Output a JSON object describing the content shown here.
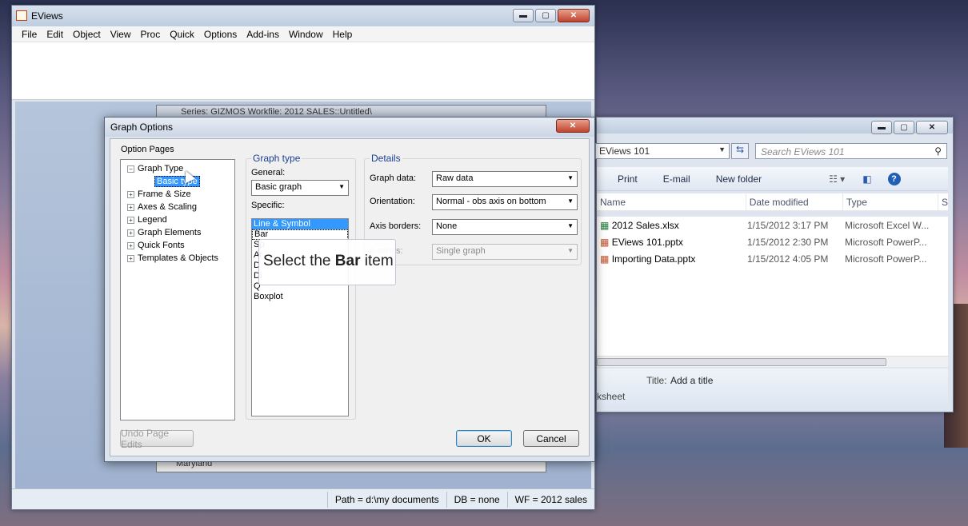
{
  "eviews": {
    "title": "EViews",
    "menu": [
      "File",
      "Edit",
      "Object",
      "View",
      "Proc",
      "Quick",
      "Options",
      "Add-ins",
      "Window",
      "Help"
    ],
    "series_title": "Series: GIZMOS   Workfile: 2012 SALES::Untitled\\",
    "series_bottom": "Maryland",
    "status": {
      "path": "Path = d:\\my documents",
      "db": "DB = none",
      "wf": "WF = 2012 sales"
    }
  },
  "explorer": {
    "address": "EViews 101",
    "search_placeholder": "Search EViews 101",
    "toolbar": {
      "print": "Print",
      "email": "E-mail",
      "new_folder": "New folder"
    },
    "columns": {
      "name": "Name",
      "date": "Date modified",
      "type": "Type",
      "size": "Si"
    },
    "files": [
      {
        "name": "2012 Sales.xlsx",
        "date": "1/15/2012 3:17 PM",
        "type": "Microsoft Excel W..."
      },
      {
        "name": "EViews 101.pptx",
        "date": "1/15/2012 2:30 PM",
        "type": "Microsoft PowerP..."
      },
      {
        "name": "Importing Data.pptx",
        "date": "1/15/2012 4:05 PM",
        "type": "Microsoft PowerP..."
      }
    ],
    "details": {
      "title_label": "Title:",
      "title_value": "Add a title",
      "sheet": "ksheet"
    }
  },
  "dialog": {
    "title": "Graph Options",
    "option_pages_label": "Option Pages",
    "tree": [
      {
        "label": "Graph Type",
        "expander": "−"
      },
      {
        "label": "Basic type",
        "child": true,
        "selected": true
      },
      {
        "label": "Frame & Size",
        "expander": "+"
      },
      {
        "label": "Axes & Scaling",
        "expander": "+"
      },
      {
        "label": "Legend",
        "expander": "+"
      },
      {
        "label": "Graph Elements",
        "expander": "+"
      },
      {
        "label": "Quick Fonts",
        "expander": "+"
      },
      {
        "label": "Templates & Objects",
        "expander": "+"
      }
    ],
    "graph_type": {
      "group_label": "Graph type",
      "general_label": "General:",
      "general_value": "Basic graph",
      "specific_label": "Specific:",
      "specific_items": [
        "Line & Symbol",
        "Bar",
        "Spike",
        "Area",
        "Dot Plot",
        "Distribution",
        "Quantile - Quantile",
        "Boxplot"
      ],
      "specific_items_visible": [
        "Line & Symbol",
        "Bar",
        "Sp",
        "Ar",
        "D",
        "Di",
        "Q",
        "Boxplot"
      ]
    },
    "details": {
      "group_label": "Details",
      "graph_data_label": "Graph data:",
      "graph_data_value": "Raw data",
      "orientation_label": "Orientation:",
      "orientation_value": "Normal - obs axis on bottom",
      "axis_borders_label": "Axis borders:",
      "axis_borders_value": "None",
      "multi_series_label": "e series:",
      "multi_series_value": "Single graph"
    },
    "buttons": {
      "undo": "Undo Page Edits",
      "ok": "OK",
      "cancel": "Cancel"
    },
    "tooltip": {
      "pre": "Select the ",
      "bold": "Bar",
      "post": " item"
    }
  }
}
